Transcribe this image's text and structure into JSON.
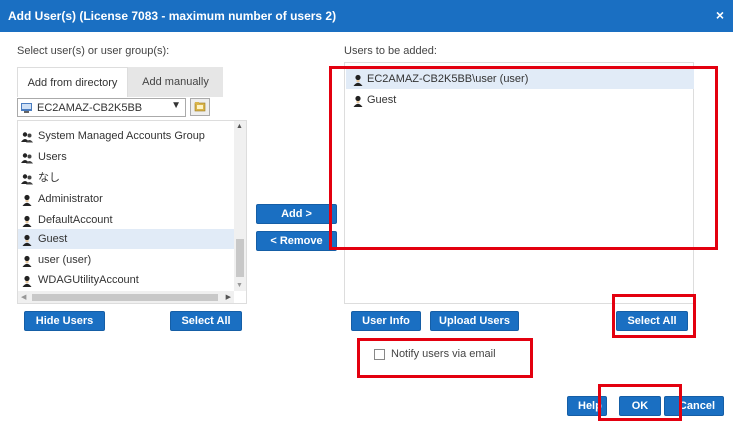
{
  "dialog": {
    "title": "Add User(s) (License 7083 - maximum number of users 2)",
    "close_glyph": "×"
  },
  "left": {
    "section_label": "Select user(s) or user group(s):",
    "tabs": [
      {
        "label": "Add from directory",
        "active": true
      },
      {
        "label": "Add manually",
        "active": false
      }
    ],
    "directory": {
      "selected": "EC2AMAZ-CB2K5BB"
    },
    "items": [
      {
        "label": "System Managed Accounts Group",
        "icon": "user-group-icon",
        "selected": false
      },
      {
        "label": "Users",
        "icon": "user-group-icon",
        "selected": false
      },
      {
        "label": "なし",
        "icon": "user-group-icon",
        "selected": false
      },
      {
        "label": "Administrator",
        "icon": "user-icon",
        "selected": false
      },
      {
        "label": "DefaultAccount",
        "icon": "user-icon",
        "selected": false
      },
      {
        "label": "Guest",
        "icon": "user-icon",
        "selected": true
      },
      {
        "label": "user (user)",
        "icon": "user-icon",
        "selected": false
      },
      {
        "label": "WDAGUtilityAccount",
        "icon": "user-icon",
        "selected": false
      }
    ],
    "hide_users_label": "Hide Users",
    "select_all_label": "Select All"
  },
  "middle": {
    "add_label": "Add >",
    "remove_label": "< Remove"
  },
  "right": {
    "section_label": "Users to be added:",
    "items": [
      {
        "label": "EC2AMAZ-CB2K5BB\\user (user)",
        "icon": "user-icon",
        "selected": true
      },
      {
        "label": "Guest",
        "icon": "user-icon",
        "selected": false
      }
    ],
    "user_info_label": "User Info",
    "upload_users_label": "Upload Users",
    "select_all_label": "Select All",
    "notify_label": "Notify users via email",
    "notify_checked": false
  },
  "footer": {
    "help_label": "Help",
    "ok_label": "OK",
    "cancel_label": "Cancel"
  },
  "colors": {
    "title_bar": "#1a6fc2",
    "button": "#1a6fc2",
    "selection": "#e1ebf7",
    "highlight_border": "#e3000f"
  }
}
